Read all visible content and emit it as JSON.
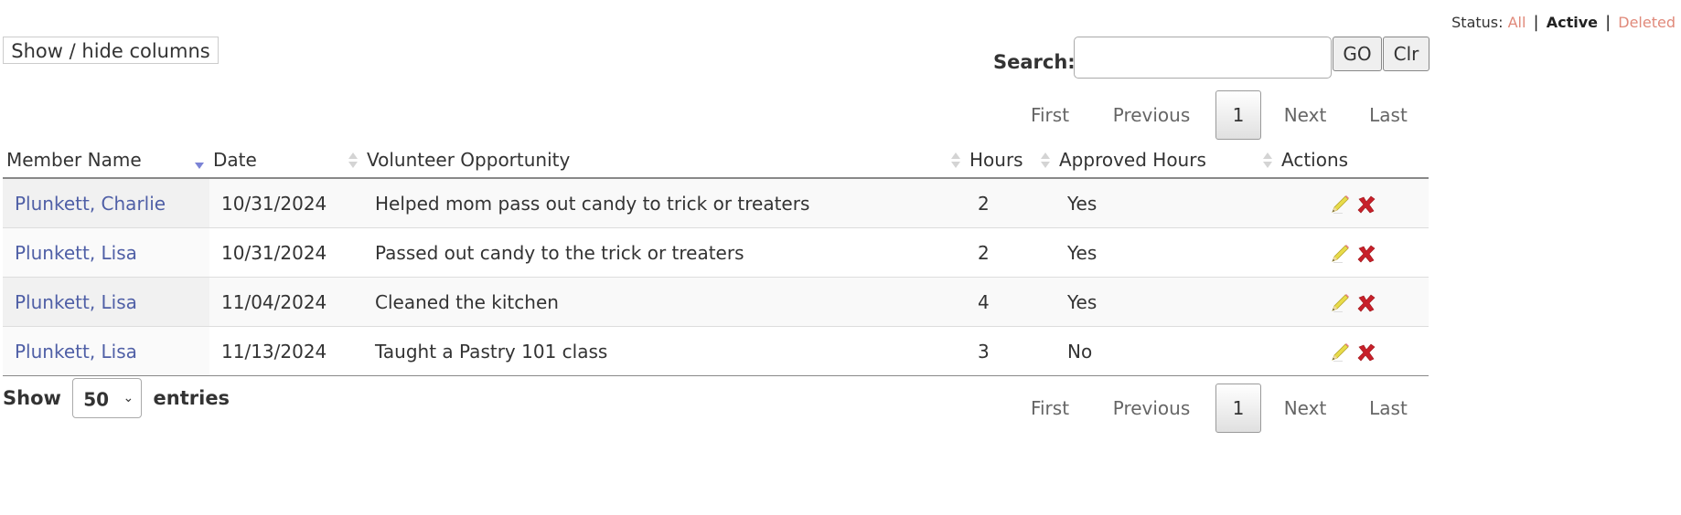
{
  "status_filter": {
    "label": "Status:",
    "options": [
      {
        "label": "All",
        "active": false
      },
      {
        "label": "Active",
        "active": true
      },
      {
        "label": "Deleted",
        "active": false
      }
    ],
    "separator": "|",
    "link_color": "#e0897a"
  },
  "toolbar": {
    "show_hide_label": "Show / hide columns",
    "search_label": "Search:",
    "search_value": "",
    "search_placeholder": "",
    "go_label": "GO",
    "clear_label": "Clr"
  },
  "pagination": {
    "first": "First",
    "previous": "Previous",
    "current_page": "1",
    "next": "Next",
    "last": "Last"
  },
  "table": {
    "columns": [
      {
        "label": "Member Name",
        "sort": "desc-active"
      },
      {
        "label": "Date",
        "sort": "both"
      },
      {
        "label": "Volunteer Opportunity",
        "sort": "both"
      },
      {
        "label": "Hours",
        "sort": "both"
      },
      {
        "label": "Approved Hours",
        "sort": "both"
      },
      {
        "label": "Actions",
        "sort": "none"
      }
    ],
    "rows": [
      {
        "member": "Plunkett, Charlie",
        "date": "10/31/2024",
        "opportunity": "Helped mom pass out candy to trick or treaters",
        "hours": "2",
        "approved": "Yes",
        "actions": [
          "edit-icon",
          "delete-icon"
        ]
      },
      {
        "member": "Plunkett, Lisa",
        "date": "10/31/2024",
        "opportunity": "Passed out candy to the trick or treaters",
        "hours": "2",
        "approved": "Yes",
        "actions": [
          "edit-icon",
          "delete-icon"
        ]
      },
      {
        "member": "Plunkett, Lisa",
        "date": "11/04/2024",
        "opportunity": "Cleaned the kitchen",
        "hours": "4",
        "approved": "Yes",
        "actions": [
          "edit-icon",
          "delete-icon"
        ]
      },
      {
        "member": "Plunkett, Lisa",
        "date": "11/13/2024",
        "opportunity": "Taught a Pastry 101 class",
        "hours": "3",
        "approved": "No",
        "actions": [
          "edit-icon",
          "delete-icon"
        ]
      }
    ],
    "link_color": "#4f5fa6",
    "sort_active_color": "#7b83d6"
  },
  "length_menu": {
    "prefix": "Show",
    "selected": "50",
    "suffix": "entries"
  }
}
